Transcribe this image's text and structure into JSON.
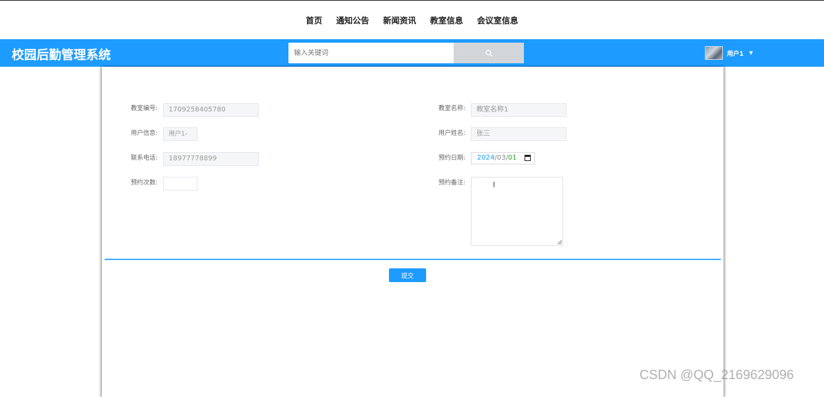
{
  "nav": {
    "links": [
      "首页",
      "通知公告",
      "新闻资讯",
      "教室信息",
      "会议室信息"
    ]
  },
  "header": {
    "title": "校园后勤管理系统",
    "search_placeholder": "输入关键词",
    "search_icon": "search-icon",
    "username": "用户1",
    "brand_color": "#1e9bff"
  },
  "form": {
    "classroom_no_label": "教室编号:",
    "classroom_no_value": "1709258405780",
    "classroom_name_label": "教室名称:",
    "classroom_name_value": "教室名称1",
    "user_info_label": "用户信息:",
    "user_info_value": "用户1-",
    "user_name_label": "用户姓名:",
    "user_name_value": "张三",
    "phone_label": "联系电话:",
    "phone_value": "18977778899",
    "date_label": "预约日期:",
    "date_year": "2024",
    "date_month": "03",
    "date_day": "01",
    "count_label": "预约次数:",
    "count_value": "",
    "remark_label": "预约备注:",
    "submit_label": "提交"
  },
  "watermark": "CSDN @QQ_2169629096"
}
